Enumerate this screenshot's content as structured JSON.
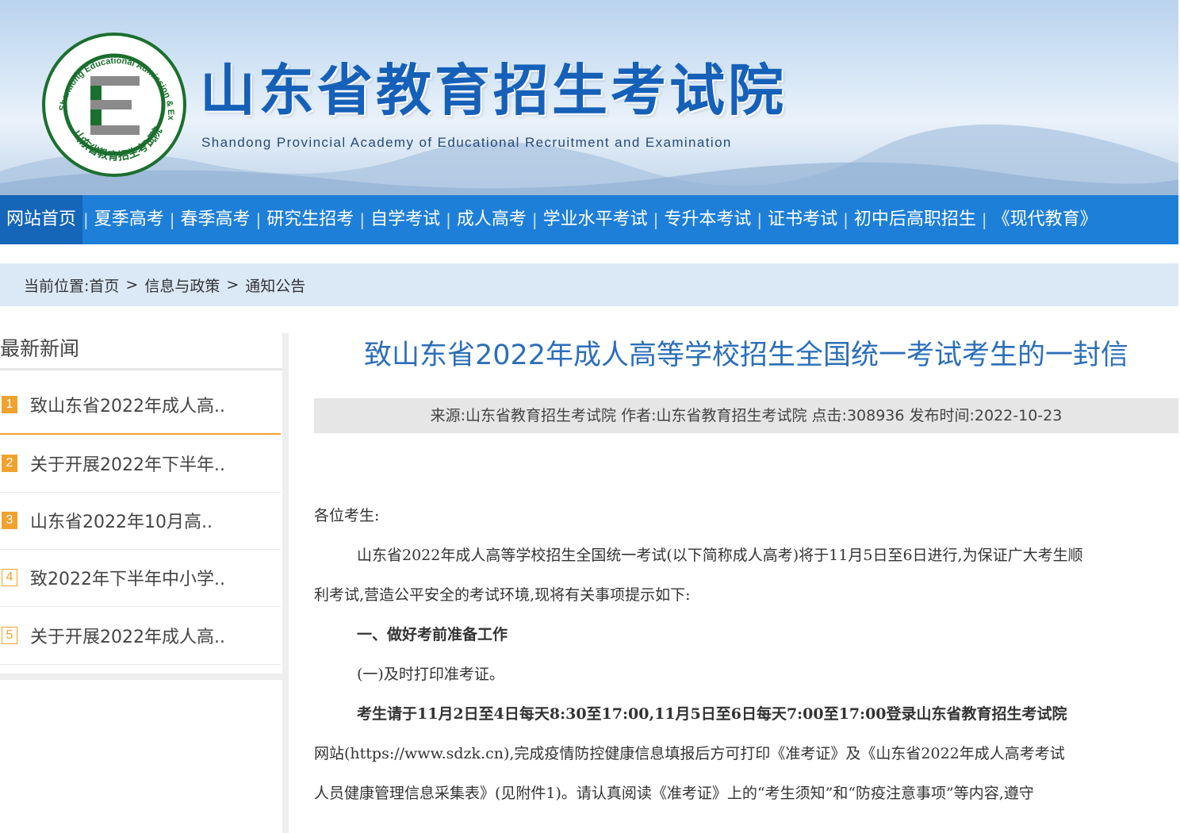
{
  "banner": {
    "title": "山东省教育招生考试院",
    "subtitle": "Shandong Provincial Academy of Educational Recruitment and Examination",
    "logo_letter": "E",
    "logo_ring_text": "Shandong Educational Admission & Examinations",
    "logo_bottom_text": "山东省教育招生考试院"
  },
  "nav": {
    "items": [
      {
        "label": "网站首页"
      },
      {
        "label": "夏季高考"
      },
      {
        "label": "春季高考"
      },
      {
        "label": "研究生招考"
      },
      {
        "label": "自学考试"
      },
      {
        "label": "成人高考"
      },
      {
        "label": "学业水平考试"
      },
      {
        "label": "专升本考试"
      },
      {
        "label": "证书考试"
      },
      {
        "label": "初中后高职招生"
      },
      {
        "label": "《现代教育》"
      }
    ],
    "separator": "|"
  },
  "breadcrumb": {
    "lead": "当前位置:",
    "crumbs": [
      "首页",
      "信息与政策",
      "通知公告"
    ],
    "separator": ">"
  },
  "sidebar": {
    "title": "最新新闻",
    "items": [
      {
        "num": "1",
        "text": "致山东省2022年成人高.."
      },
      {
        "num": "2",
        "text": "关于开展2022年下半年.."
      },
      {
        "num": "3",
        "text": "山东省2022年10月高.."
      },
      {
        "num": "4",
        "text": "致2022年下半年中小学.."
      },
      {
        "num": "5",
        "text": "关于开展2022年成人高.."
      }
    ]
  },
  "article": {
    "title": "致山东省2022年成人高等学校招生全国统一考试考生的一封信",
    "meta": "来源:山东省教育招生考试院 作者:山东省教育招生考试院 点击:308936 发布时间:2022-10-23",
    "lines": [
      "各位考生:",
      "山东省2022年成人高等学校招生全国统一考试(以下简称成人高考)将于11月5日至6日进行,为保证广大考生顺",
      "利考试,营造公平安全的考试环境,现将有关事项提示如下:",
      "一、做好考前准备工作",
      "(一)及时打印准考证。",
      "考生请于11月2日至4日每天8:30至17:00,11月5日至6日每天7:00至17:00登录山东省教育招生考试院",
      "网站(https://www.sdzk.cn),完成疫情防控健康信息填报后方可打印《准考证》及《山东省2022年成人高考考试",
      "人员健康管理信息采集表》(见附件1)。请认真阅读《准考证》上的“考生须知”和“防疫注意事项”等内容,遵守"
    ]
  },
  "colors": {
    "nav_bg": "#1e7fd8",
    "nav_active": "#1565b8",
    "title_blue": "#2c6fb8",
    "accent_orange": "#f0a22e",
    "breadcrumb_bg": "#dbe9f7"
  }
}
